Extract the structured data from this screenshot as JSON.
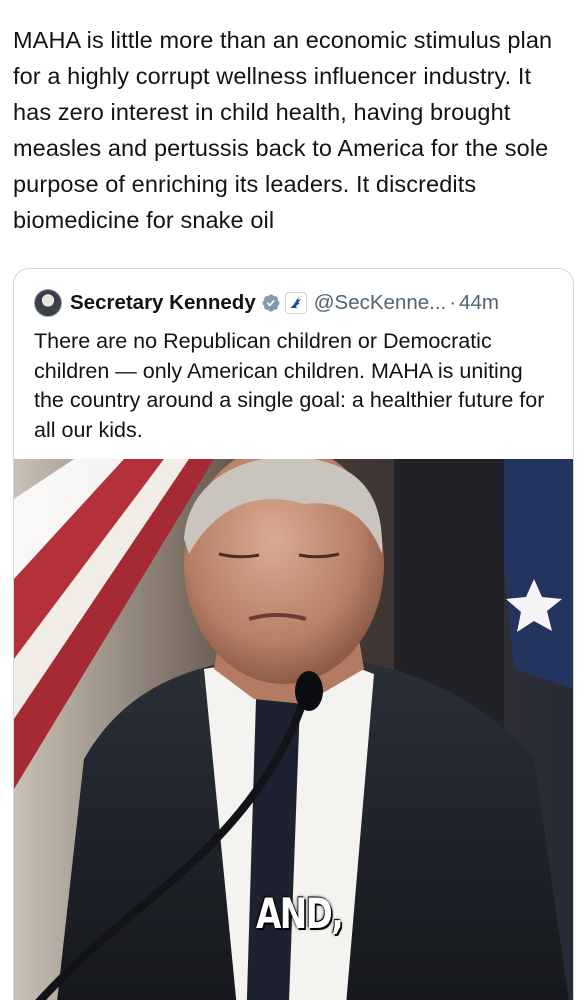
{
  "post": {
    "text": "MAHA is little more than an economic stimulus plan for a highly corrupt wellness influencer industry. It has zero interest in child health, having brought measles and pertussis back to America for the sole purpose of enriching its leaders. It discredits biomedicine for snake oil"
  },
  "quoted_post": {
    "author_name": "Secretary Kennedy",
    "handle": "@SecKenne...",
    "separator": "·",
    "time": "44m",
    "text": "There are no Republican children or Democratic children — only American children. MAHA is uniting the country around a single goal: a healthier future for all our kids.",
    "verified_icon": "verified-badge-icon",
    "affiliation_icon": "hhs-eagle-icon",
    "media": {
      "caption": "AND,",
      "description_icon": "video-frame"
    }
  },
  "colors": {
    "text_primary": "#0f1419",
    "text_secondary": "#536471",
    "border": "#cfd9de",
    "verified": "#829aab"
  }
}
